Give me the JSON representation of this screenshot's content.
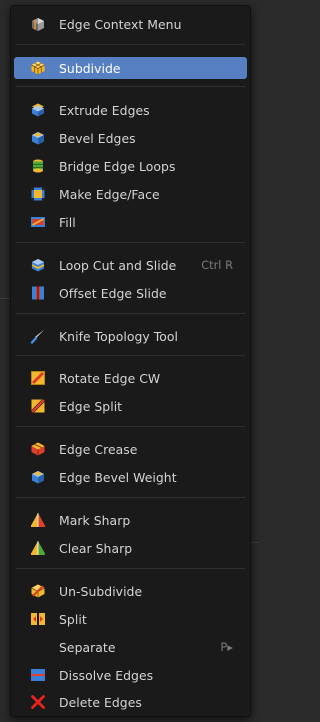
{
  "menu": {
    "title": "Edge Context Menu",
    "items": {
      "subdivide": "Subdivide",
      "extrude_edges": "Extrude Edges",
      "bevel_edges": "Bevel Edges",
      "bridge_edge_loops": "Bridge Edge Loops",
      "make_edge_face": "Make Edge/Face",
      "fill": "Fill",
      "loop_cut_and_slide": "Loop Cut and Slide",
      "loop_cut_shortcut": "Ctrl R",
      "offset_edge_slide": "Offset Edge Slide",
      "knife_topology_tool": "Knife Topology Tool",
      "rotate_edge_cw": "Rotate Edge CW",
      "edge_split": "Edge Split",
      "edge_crease": "Edge Crease",
      "edge_bevel_weight": "Edge Bevel Weight",
      "mark_sharp": "Mark Sharp",
      "clear_sharp": "Clear Sharp",
      "un_subdivide": "Un-Subdivide",
      "split": "Split",
      "separate": "Separate",
      "separate_shortcut": "P▸",
      "dissolve_edges": "Dissolve Edges",
      "delete_edges": "Delete Edges"
    },
    "active_item": "Subdivide"
  },
  "colors": {
    "menu_background": "#1a1a1a",
    "highlight": "#5680c2",
    "text": "#d4d4d4",
    "shortcut_text": "#7a7a7a"
  },
  "icons": {
    "header": "edge-menu-icon",
    "subdivide": "subdivide-icon",
    "extrude_edges": "extrude-icon",
    "bevel_edges": "bevel-icon",
    "bridge_edge_loops": "bridge-loops-icon",
    "make_edge_face": "make-face-icon",
    "fill": "fill-icon",
    "loop_cut_and_slide": "loop-cut-icon",
    "offset_edge_slide": "offset-slide-icon",
    "knife_topology_tool": "knife-icon",
    "rotate_edge_cw": "rotate-edge-icon",
    "edge_split": "edge-split-icon",
    "edge_crease": "crease-icon",
    "edge_bevel_weight": "bevel-weight-icon",
    "mark_sharp": "mark-sharp-icon",
    "clear_sharp": "clear-sharp-icon",
    "un_subdivide": "un-subdivide-icon",
    "split": "split-icon",
    "dissolve_edges": "dissolve-icon",
    "delete_edges": "delete-icon"
  }
}
